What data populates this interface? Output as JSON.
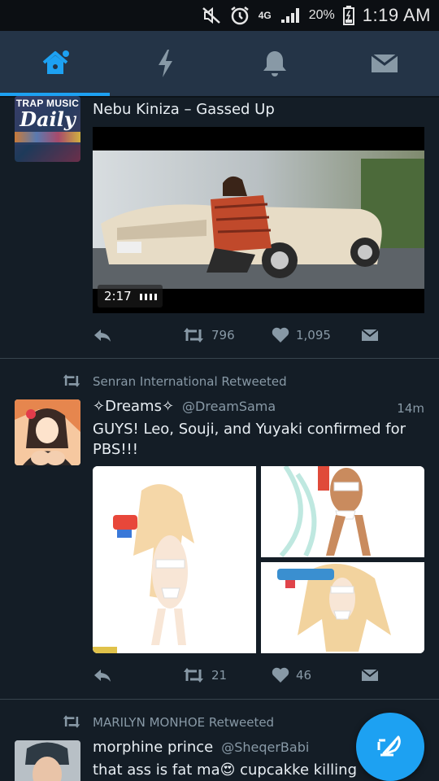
{
  "status_bar": {
    "network": "4G",
    "battery_percent": "20%",
    "time": "1:19 AM",
    "icons": [
      "mute-icon",
      "alarm-icon",
      "signal-icon",
      "battery-charging-icon"
    ]
  },
  "tabs": [
    {
      "name": "home",
      "icon": "home-icon",
      "active": true
    },
    {
      "name": "moments",
      "icon": "lightning-icon",
      "active": false
    },
    {
      "name": "notifications",
      "icon": "bell-icon",
      "active": false
    },
    {
      "name": "messages",
      "icon": "envelope-icon",
      "active": false
    }
  ],
  "tweets": [
    {
      "avatar_text_top": "TRAP MUSIC",
      "avatar_text_bottom": "Daily",
      "text": "Nebu Kiniza – Gassed Up",
      "video": {
        "duration": "2:17"
      },
      "actions": {
        "retweets": "796",
        "likes": "1,095"
      }
    },
    {
      "retweeted_by": "Senran International Retweeted",
      "name": "✧Dreams✧",
      "handle": "@DreamSama",
      "time": "14m",
      "text_line1": "GUYS! Leo, Souji, and Yuyaki confirmed for",
      "text_line2": "PBS!!!",
      "actions": {
        "retweets": "21",
        "likes": "46"
      }
    },
    {
      "retweeted_by": "MARILYN MONHOE Retweeted",
      "name": "morphine prince",
      "handle": "@SheqerBabi",
      "text": "that ass is fat ma😍 cupcakke killing"
    }
  ],
  "colors": {
    "background": "#141d26",
    "tabbar": "#243447",
    "accent": "#1da1f2",
    "muted": "#8899a6"
  }
}
